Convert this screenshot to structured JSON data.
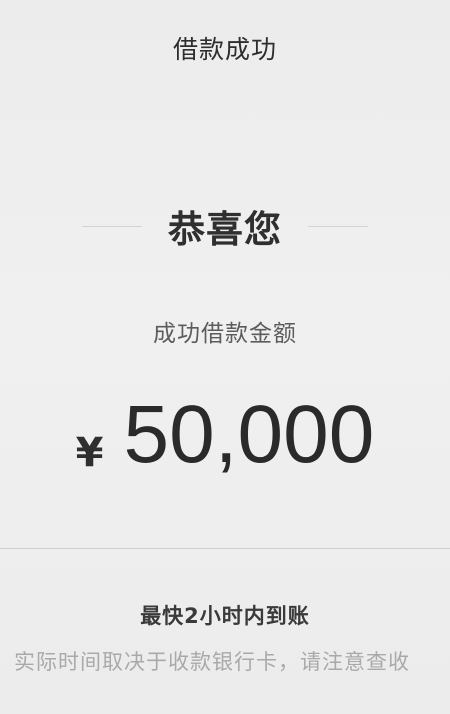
{
  "header": {
    "title": "借款成功"
  },
  "result": {
    "congrats": "恭喜您",
    "amount_label": "成功借款金额",
    "currency": "¥",
    "amount": "50,000"
  },
  "footer": {
    "arrival_time": "最快2小时内到账",
    "note": "实际时间取决于收款银行卡，请注意查收"
  }
}
